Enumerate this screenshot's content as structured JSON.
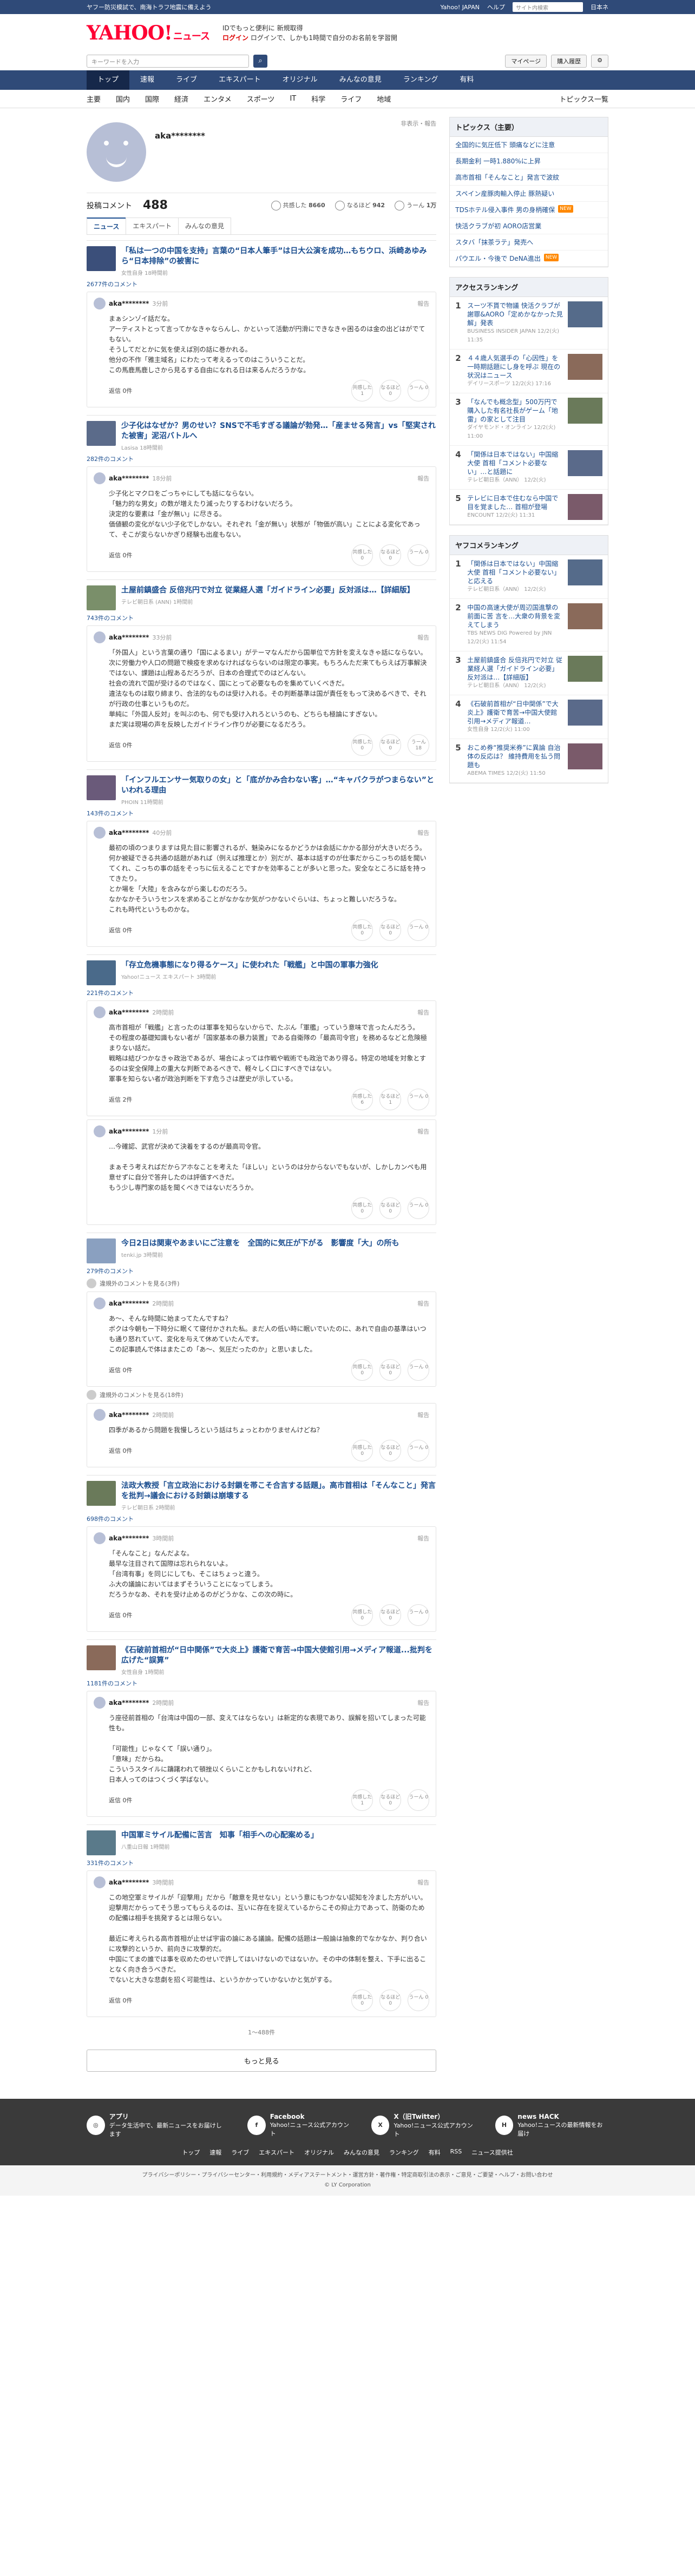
{
  "topbar": {
    "notice": "ヤフー防災模試で、南海トラフ地震に備えよう",
    "right_links": [
      "Yahoo! JAPAN",
      "ヘルプ"
    ],
    "search_placeholder": "サイト内検索",
    "region": "日本ネ"
  },
  "brand": {
    "logo": "YAHOO!",
    "logo_sub": "ニュース",
    "line1_label": "ログイン",
    "line1": "IDでもっと便利に 新規取得",
    "line2": "ログインで、しかも1時間で自分のお名前を学習開"
  },
  "search": {
    "placeholder": "キーワードを入力",
    "mypage": "マイページ",
    "buy": "購入履歴"
  },
  "gnav": [
    "トップ",
    "速報",
    "ライブ",
    "エキスパート",
    "オリジナル",
    "みんなの意見",
    "ランキング",
    "有料"
  ],
  "snav": [
    "主要",
    "国内",
    "国際",
    "経済",
    "エンタメ",
    "スポーツ",
    "IT",
    "科学",
    "ライフ",
    "地域"
  ],
  "snav_right": "トピックス一覧",
  "profile": {
    "name": "aka********",
    "report": "非表示・報告",
    "comments_label": "投稿コメント",
    "comments_count": "488",
    "r1_label": "共感した",
    "r1": "8660",
    "r2_label": "なるほど",
    "r2": "942",
    "r3_label": "うーん",
    "r3": "1万"
  },
  "ptabs": [
    "ニュース",
    "エキスパート",
    "みんなの意見"
  ],
  "items": [
    {
      "title": "「私は一つの中国を支持」言葉の“日本人筆手”は日大公演を成功…もちウロ、浜崎あゆみら“日本排除”の被害に",
      "source": "女性自身 18時間前",
      "count": "2677件のコメント",
      "comments": [
        {
          "name": "aka********",
          "time": "3分前",
          "text": "まぁシンゾイ話だな。\nアーティストとって言ってかなきゃならんし、かといって活動が円滑にできなきゃ困るのは金の出どはがでてもない。\nそうしてだとかに気を使えば別の話に巻かれる。\n他分の不作「雅主域名」にわたって考えるってのはこういうことだ。\nこの馬鹿馬鹿しさから見るする自由になれる日は来るんだろうかな。",
          "reply": "返信 0件",
          "b": [
            "共感した\n1",
            "なるほど\n0",
            "うーん\n0"
          ]
        }
      ]
    },
    {
      "title": "少子化はなぜか？男のせい？SNSで不毛すぎる議論が勃発…「産ませる発言」vs「堅実された被害」泥沼バトルへ",
      "source": "Lasisa 18時間前",
      "count": "282件のコメント",
      "comments": [
        {
          "name": "aka********",
          "time": "18分前",
          "text": "少子化とマクロをごっちゃにしても話にならない。\n「魅力的な男女」の数が増えたり減ったりするわけないだろう。\n決定的な要素は「金が無い」に尽きる。\n価値観の変化がない少子化でしかない。それぞれ「金が無い」状態が「物価が高い」ことによる変化であって、そこが変らないかぎり経験も出産もない。",
          "reply": "返信 0件",
          "b": [
            "共感した\n0",
            "なるほど\n0",
            "うーん\n0"
          ]
        }
      ]
    },
    {
      "title": "土屋前鎮盛合 反倍兆円で対立 従業経人選「ガイドライン必要」反対派は…【詳細版】",
      "source": "テレビ朝日系 (ANN) 1時間前",
      "count": "743件のコメント",
      "comments": [
        {
          "name": "aka********",
          "time": "33分前",
          "text": "「外国人」という言葉の通り「国によるまい」がテーマなんだから国単位で方針を変えなきゃ話にならない。\n次に労働力や人口の問題で検疫を求めなければならないのは限定の事実。もちろんただ来てもらえば万事解決ではない、課題は山程あるだろうが、日本の合理式でのはどんない。\n社会の流れで国が受けるのではなく、国にとって必要なものを集めていくべきだ。\n違法なものは取り締まり、合法的なものは受け入れる。その判断基準は国が責任をもって決めるべきで、それが行政の仕事というものだ。\n単純に「外国人反対」を叫ぶのも、何でも受け入れろというのも、どちらも極論にすぎない。\nまだ実は現場の声を反映したガイドライン作りが必要になるだろう。",
          "reply": "返信 0件",
          "b": [
            "共感した\n0",
            "なるほど\n0",
            "うーん\n18"
          ]
        }
      ]
    },
    {
      "title": "「インフルエンサー気取りの女」と「底がかみ合わない客」…“キャバクラがつまらない”といわれる理由",
      "source": "PHOIN 11時間前",
      "count": "143件のコメント",
      "comments": [
        {
          "name": "aka********",
          "time": "40分前",
          "text": "最初の頃のつまりますは見た目に影響されるが、魅染みになるかどうかは会話にかかる部分が大きいだろう。\n何か被疑できる共通の話題があれば（例えば推理とか）別だが、基本は話すのが仕事だからこっちの話を聞いてくれ、こっちの事の話をそっちに伝えることですかを効率ることが多いと思った。安全なところに話を持ってきたり。\nとか場を「大陸」を含みながら楽しむのだろう。\nなかなかそういうセンスを求めることがなかなか気がつかないぐらいは、ちょっと難しいだろうな。\nこれも時代というものかな。",
          "reply": "返信 0件",
          "b": [
            "共感した\n0",
            "なるほど\n0",
            "うーん\n0"
          ]
        }
      ]
    },
    {
      "title": "「存立危機事態になり得るケース」に使われた「戦艦」と中国の軍事力強化",
      "source": "Yahoo!ニュース エキスパート 3時間前",
      "count": "221件のコメント",
      "comments": [
        {
          "name": "aka********",
          "time": "2時間前",
          "text": "高市首相が「戦艦」と言ったのは軍事を知らないからで、たぶん「軍艦」っていう意味で言ったんだろう。\nその程度の基礎知識もない者が「国家基本の暴力装置」である自衛隊の「最高司令官」を務めるなどと危険極まりない話だ。\n戦略は結びつかなきゃ政治であるが、場合によっては作戦や戦術でも政治であり得る。特定の地域を対象とするのは安全保障上の重大な判断であるべきで、軽々しく口にすべきではない。\n軍事を知らない者が政治判断を下す危うさは歴史が示している。",
          "reply": "返信 2件",
          "b": [
            "共感した\n6",
            "なるほど\n1",
            "うーん\n0"
          ]
        },
        {
          "name": "aka********",
          "time": "1分前",
          "text": "…今確認、武官が決めて決着をするのが最高司令官。\n\nまぁそう考えればだからアホなことを考えた「ほしい」というのは分からないでもないが、しかしカンペも用意せずに自分で答弁したのは評価すべきだ。\nもう少し専門家の話を聞くべきではないだろうか。",
          "reply": "",
          "b": [
            "共感した\n0",
            "なるほど\n0",
            "うーん\n0"
          ]
        }
      ]
    },
    {
      "title": "今日2日は関東やあまいにご注意を　全国的に気圧が下がる　影響度「大」の所も",
      "source": "tenki.jp 3時間前",
      "count": "279件のコメント",
      "comments": [
        {
          "name": "aka********",
          "time": "2時間前",
          "text": "あ〜、そんな時間に始まってたんですね？\nボクは今朝もー下時分に眠くて寝付かされた私。まだ人の低い時に眠いでいたのに、あれで自由の基準はいつも通り怒れていて、変化を与えて休めていたんです。\nこの記事読んで体はまたこの「あ〜、気圧だったのか」と思いました。",
          "reply": "返信 0件",
          "b": [
            "共感した\n0",
            "なるほど\n0",
            "うーん\n0"
          ]
        },
        {
          "name": "aka********",
          "time": "2時間前",
          "text": "四季があるから問題を我慢しろという話はちょっとわかりませんけどね？",
          "reply": "返信 0件",
          "b": [
            "共感した\n0",
            "なるほど\n0",
            "うーん\n0"
          ]
        }
      ],
      "hidden": [
        "違規外のコメントを見る(3件)",
        "違規外のコメントを見る(18件)"
      ]
    },
    {
      "title": "法政大教授「言立政治における封鎖を帯こそ合言する話題」。高市首相は「そんなこと」発言を批判→議会における封鎖は崩壊する",
      "source": "テレビ朝日系 2時間前",
      "count": "698件のコメント",
      "comments": [
        {
          "name": "aka********",
          "time": "3時間前",
          "text": "「そんなこと」なんだよな。\n最早な注目されて国際は忘れられないよ。\n「台湾有事」を同じにしても、そこはちょっと違う。\nふ大の議論においてはまずそういうことになってしまう。\nだろうかなあ、それを受け止めるのがどうかな、この次の時に。",
          "reply": "返信 0件",
          "b": [
            "共感した\n0",
            "なるほど\n0",
            "うーん\n0"
          ]
        }
      ]
    },
    {
      "title": "《石破前首相が“日中関係”で大炎上》護衛で育苦→中国大使館引用→メディア報道...批判を広げた“誤算”",
      "source": "女性自身 1時間前",
      "count": "1181件のコメント",
      "comments": [
        {
          "name": "aka********",
          "time": "2時間前",
          "text": "う座径前首相の「台湾は中国の一部、変えてはならない」は新定的な表現であり、誤解を招いてしまった可能性も。\n\n「可能性」じゃなくて「誤い通り」。\n「意味」だからね。\nこういうスタイルに躊躇われて頓挫以くらいことかもしれないけれど、\n日本人ってのはつくづく学ばない。",
          "reply": "返信 0件",
          "b": [
            "共感した\n1",
            "なるほど\n0",
            "うーん\n0"
          ]
        }
      ]
    },
    {
      "title": "中国軍ミサイル配備に苦言　知事「相手への心配案める」",
      "source": "八重山日報 1時間前",
      "count": "331件のコメント",
      "comments": [
        {
          "name": "aka********",
          "time": "3時間前",
          "text": "この地空軍ミサイルが「迎撃用」だから「敵意を見せない」という意にもつかない認知を冷ました方がいい。\n迎撃用だからってそう思ってもらえるのは、互いに存在を捉えているからこその抑止力であって、防衛のための配備は相手を挑発するとは限らない。\n\n最近に考えられる高市首相が止せば宇宙の論にある議論。配備の話題は一般論は抽象的でなかなか、判り合いに攻撃的というか、前向きに攻撃的だ。\n中国にてまの誰では事を収めたのせいで許してはいけないのではないか。その中の体制を整え、下手に出ることなく向き合うべきだ。\nでないと大きな悲劇を招く可能性は、というかかっていかないかと気がする。",
          "reply": "返信 0件",
          "b": [
            "共感した\n0",
            "なるほど\n0",
            "うーん\n0"
          ]
        }
      ]
    }
  ],
  "pager": "1〜488件",
  "more_label": "もっと見る",
  "right": {
    "topics_title": "トピックス（主要）",
    "topics": [
      {
        "t": "全国的に気圧低下 頭痛などに注意",
        "tag": ""
      },
      {
        "t": "長期金利 一時1.880%に上昇",
        "tag": ""
      },
      {
        "t": "高市首相「そんなこと」発言で波紋",
        "tag": ""
      },
      {
        "t": "スペイン産豚肉輸入停止 豚熱疑い",
        "tag": ""
      },
      {
        "t": "TDSホテル侵入事件 男の身柄確保",
        "tag": "new"
      },
      {
        "t": "快活クラブが初 AORO店営業",
        "tag": ""
      },
      {
        "t": "スタバ「抹茶ラテ」発売へ",
        "tag": ""
      },
      {
        "t": "パウエル・今後で DeNA進出",
        "tag": "new"
      }
    ],
    "access_title": "アクセスランキング",
    "access": [
      {
        "t": "スーツ不貰で物議 快活クラブが謝罪&AORO「定めかなかった見解」発表",
        "s": "BUSINESS INSIDER JAPAN 12/2(火) 11:35"
      },
      {
        "t": "４４歳人気選手の「心因性」を一時期話題にし身を呼ぶ 現在の状況はニュース",
        "s": "デイリースポーツ 12/2(火) 17:16"
      },
      {
        "t": "「なんでも概念型」500万円で購入した有名社長がゲーム「地雷」の家として注目",
        "s": "ダイヤモンド・オンライン 12/2(火) 11:00"
      },
      {
        "t": "「関係は日本ではない」中国縮大使 首相「コメント必要ない」…と話題に",
        "s": "テレビ朝日系（ANN） 12/2(火)"
      },
      {
        "t": "テレビに日本で住むなら中国で目を覚ました… 首相が登場",
        "s": "ENCOUNT 12/2(火) 11:31"
      }
    ],
    "yahoo_title": "ヤフコメランキング",
    "yahoo": [
      {
        "t": "「関係は日本ではない」中国縮大使 首相「コメント必要ない」と応える",
        "s": "テレビ朝日系（ANN） 12/2(火)"
      },
      {
        "t": "中国の高速大使が周辺国進撃の前面に苦 言を…大衆の背景を変えてしまう",
        "s": "TBS NEWS DIG Powered by JNN 12/2(火) 11:54"
      },
      {
        "t": "土屋前鎮盛合 反倍兆円で対立 従業経人選「ガイドライン必要」反対派は…【詳細版】",
        "s": "テレビ朝日系（ANN） 12/2(火)"
      },
      {
        "t": "《石破前首相が“日中関係”で大炎上》護衛で育苦→中国大使館引用→メディア報道…",
        "s": "女性自身 12/2(火) 11:00"
      },
      {
        "t": "おこめ券“推奨米券”に異論 自治体の反応は？ 維持費用を払う問題も",
        "s": "ABEMA TIMES 12/2(火) 11:50"
      }
    ]
  },
  "footer": {
    "apps": [
      {
        "name": "アプリ",
        "desc": "データ生活中で、最新ニュースをお届けします"
      },
      {
        "name": "Facebook",
        "desc": "Yahoo!ニュース公式アカウント"
      },
      {
        "name": "X（旧Twitter）",
        "desc": "Yahoo!ニュース公式アカウント"
      },
      {
        "name": "news HACK",
        "desc": "Yahoo!ニュースの最新情報をお届け"
      }
    ],
    "links": [
      "トップ",
      "速報",
      "ライブ",
      "エキスパート",
      "オリジナル",
      "みんなの意見",
      "ランキング",
      "有料",
      "RSS",
      "ニュース提供社"
    ],
    "bottom": "プライバシーポリシー・プライバシーセンター・利用規約・メディアステートメント・運営方針・著作権・特定商取引法の表示・ご意見・ご要望・ヘルプ・お問い合わせ",
    "copyright": "© LY Corporation"
  },
  "colors": {
    "accent": "#2f4a78",
    "link": "#1a4d8f",
    "brand": "#ff0033"
  }
}
